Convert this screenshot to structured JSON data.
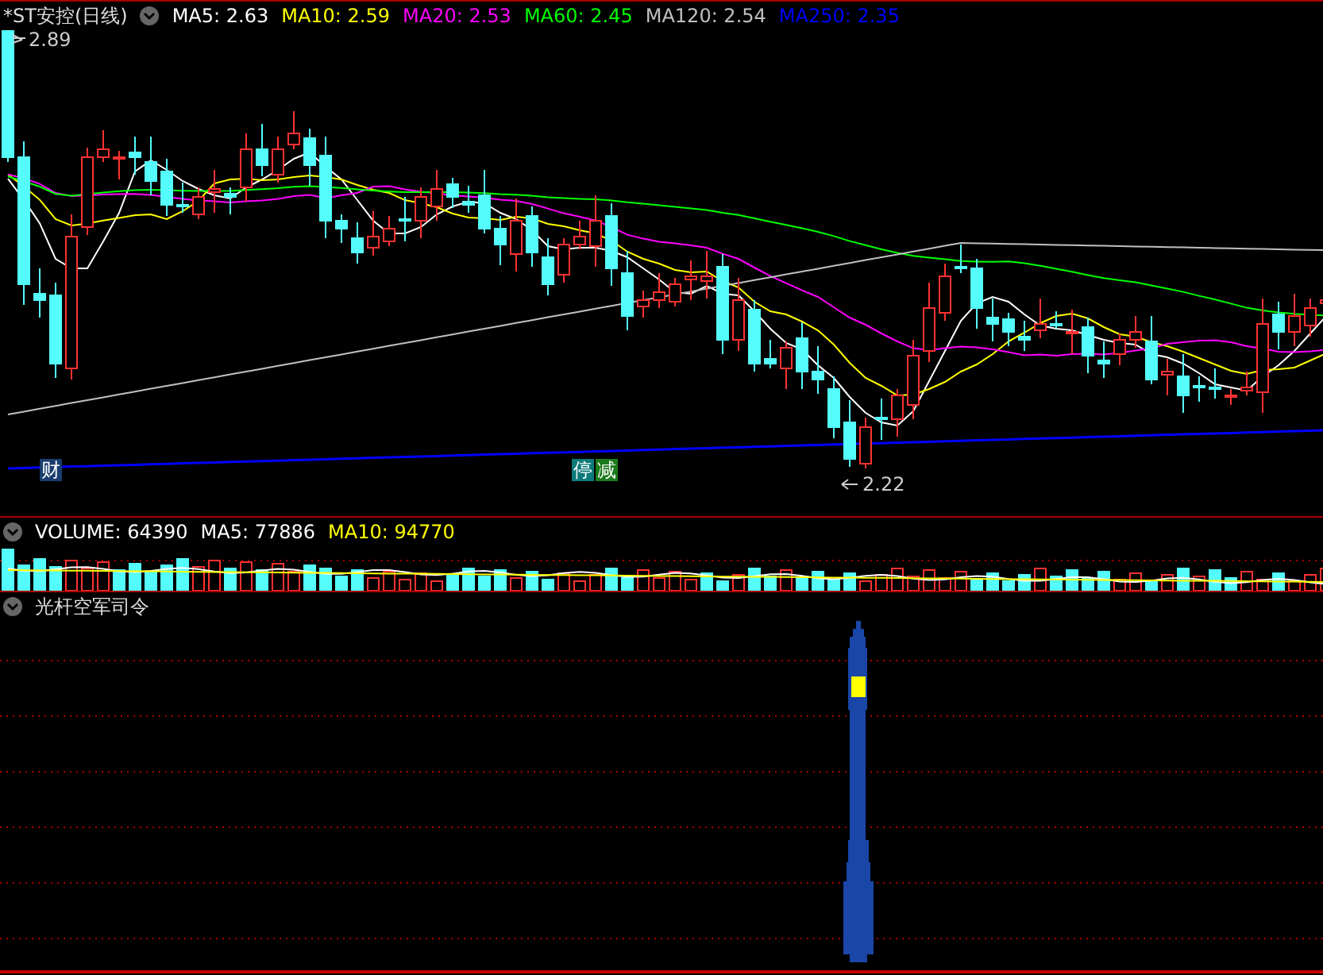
{
  "main_panel": {
    "title": "*ST安控(日线)",
    "indicators": [
      {
        "label": "MA5: 2.63",
        "color": "#ffffff"
      },
      {
        "label": "MA10: 2.59",
        "color": "#ffff00"
      },
      {
        "label": "MA20: 2.53",
        "color": "#ff00ff"
      },
      {
        "label": "MA60: 2.45",
        "color": "#00ff00"
      },
      {
        "label": "MA120: 2.54",
        "color": "#c0c0c0"
      },
      {
        "label": "MA250: 2.35",
        "color": "#0000ff"
      }
    ],
    "high_label": "2.89",
    "low_label": "2.22",
    "markers": [
      {
        "text": "财",
        "color": "#1a3d6e"
      },
      {
        "text": "停",
        "color": "#0e7a7a"
      },
      {
        "text": "减",
        "color": "#1b7a1b"
      }
    ]
  },
  "volume_panel": {
    "indicators": [
      {
        "label": "VOLUME: 64390",
        "color": "#ffffff"
      },
      {
        "label": "MA5: 77886",
        "color": "#ffffff"
      },
      {
        "label": "MA10: 94770",
        "color": "#ffff00"
      }
    ]
  },
  "indicator_panel": {
    "title": "光杆空军司令"
  }
}
